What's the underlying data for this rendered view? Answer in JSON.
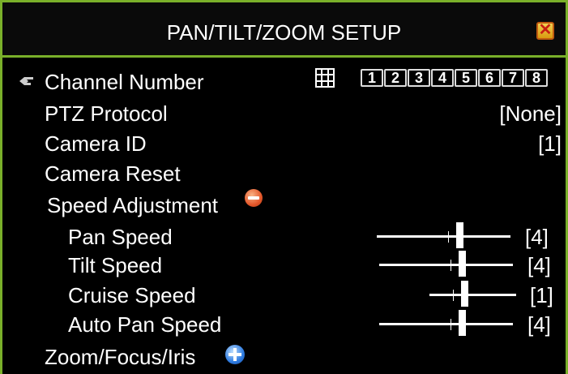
{
  "window": {
    "title": "PAN/TILT/ZOOM SETUP",
    "close_glyph": "✕"
  },
  "channel": {
    "label": "Channel Number",
    "buttons": [
      "1",
      "2",
      "3",
      "4",
      "5",
      "6",
      "7",
      "8"
    ]
  },
  "ptz_protocol": {
    "label": "PTZ Protocol",
    "value": "[None]"
  },
  "camera_id": {
    "label": "Camera ID",
    "value": "[1]"
  },
  "camera_reset": {
    "label": "Camera Reset"
  },
  "speed_adjustment": {
    "label": "Speed Adjustment",
    "pan": {
      "label": "Pan Speed",
      "value": "[4]"
    },
    "tilt": {
      "label": "Tilt Speed",
      "value": "[4]"
    },
    "cruise": {
      "label": "Cruise Speed",
      "value": "[1]"
    },
    "auto_pan": {
      "label": "Auto Pan Speed",
      "value": "[4]"
    }
  },
  "zoom_focus_iris": {
    "label": "Zoom/Focus/Iris"
  },
  "colors": {
    "border": "#7ab02a",
    "background": "#000000",
    "text": "#ffffff"
  }
}
